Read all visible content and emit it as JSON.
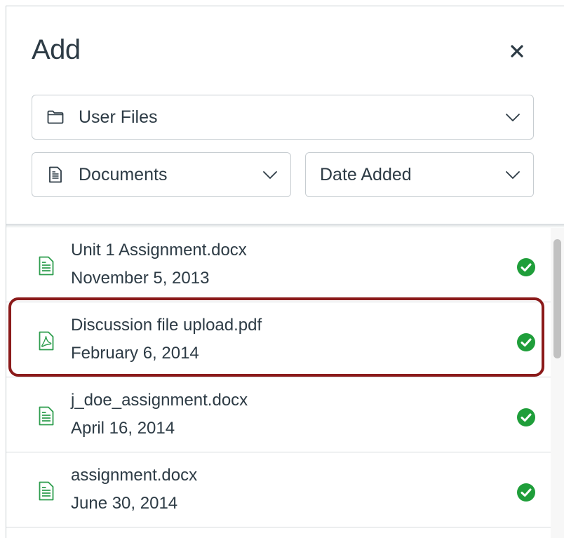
{
  "dialog": {
    "title": "Add",
    "close_label": "×"
  },
  "filters": {
    "location": {
      "label": "User Files",
      "icon": "folder-icon"
    },
    "content_type": {
      "label": "Documents",
      "icon": "document-icon"
    },
    "sort": {
      "label": "Date Added"
    }
  },
  "files": [
    {
      "name": "Unit 1 Assignment.docx",
      "date": "November 5, 2013",
      "type": "docx",
      "status": "published"
    },
    {
      "name": "Discussion file upload.pdf",
      "date": "February 6, 2014",
      "type": "pdf",
      "status": "published",
      "highlighted": true
    },
    {
      "name": "j_doe_assignment.docx",
      "date": "April 16, 2014",
      "type": "docx",
      "status": "published"
    },
    {
      "name": "assignment.docx",
      "date": "June 30, 2014",
      "type": "docx",
      "status": "published"
    }
  ],
  "colors": {
    "text": "#2d3b45",
    "border": "#c7cdd1",
    "file_icon_green": "#2e9d4e",
    "check_green": "#1f9e3a",
    "highlight": "#8b1a1a"
  }
}
